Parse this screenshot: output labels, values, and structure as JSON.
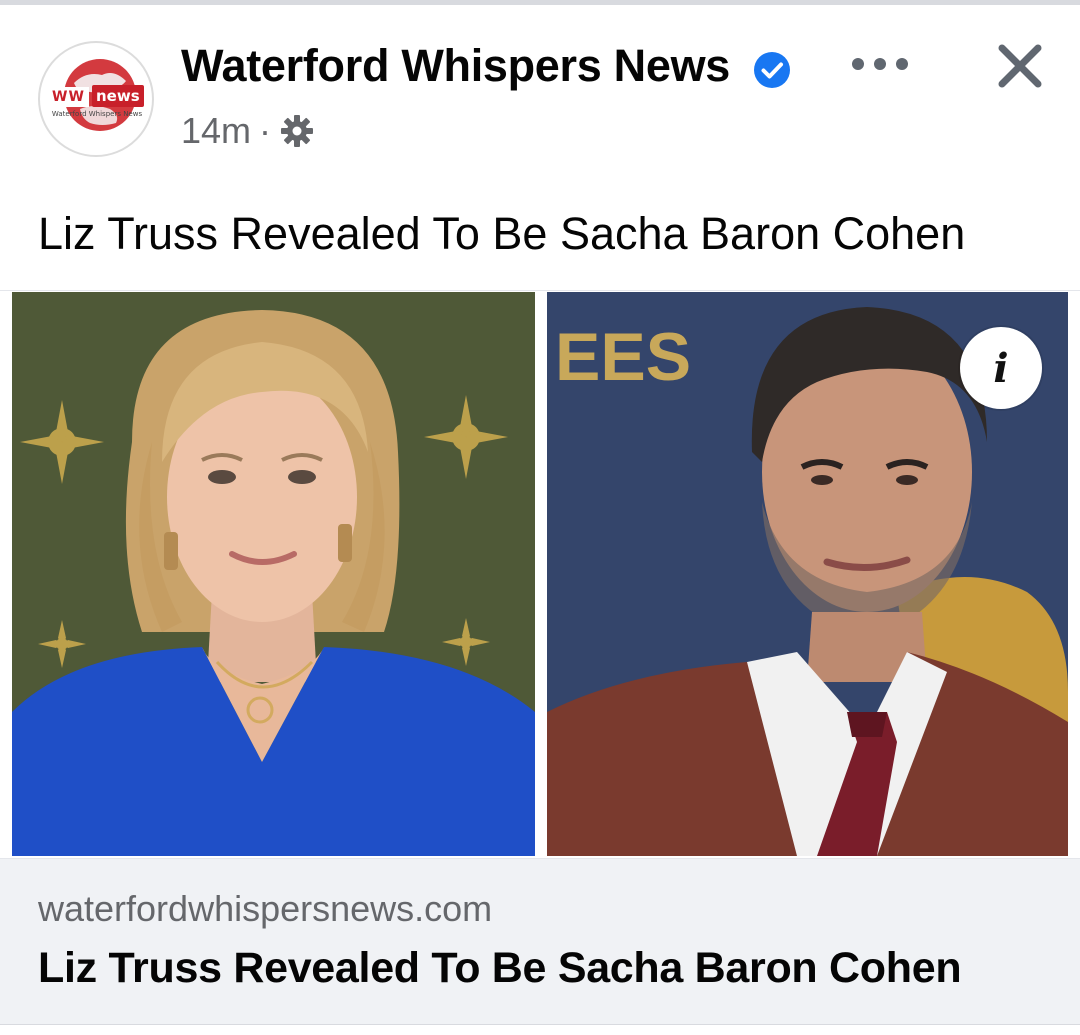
{
  "post": {
    "page_name": "Waterford Whispers News",
    "verified": true,
    "time": "14m",
    "separator": "·",
    "audience_icon": "gear-icon",
    "text": "Liz Truss Revealed To Be Sacha Baron Cohen"
  },
  "avatar_logo": {
    "ww": "WW",
    "news": "news",
    "subtitle": "Waterford Whispers News"
  },
  "media": {
    "background_letters": "EES",
    "info_label": "i"
  },
  "link_preview": {
    "domain": "waterfordwhispersnews.com",
    "title": "Liz Truss Revealed To Be Sacha Baron Cohen"
  },
  "colors": {
    "verified_blue": "#1877f2",
    "brand_red": "#c8202a",
    "secondary_text": "#65676b",
    "preview_background": "#f0f2f5"
  }
}
